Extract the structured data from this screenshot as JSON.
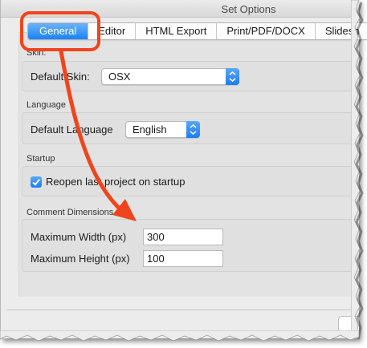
{
  "window": {
    "title": "Set Options"
  },
  "tabs": [
    {
      "label": "General",
      "active": true
    },
    {
      "label": "Editor",
      "active": false
    },
    {
      "label": "HTML Export",
      "active": false
    },
    {
      "label": "Print/PDF/DOCX",
      "active": false
    },
    {
      "label": "Slidesh",
      "active": false
    }
  ],
  "skin": {
    "group_label": "Skin:",
    "field_label": "Default Skin:",
    "value": "OSX"
  },
  "language": {
    "group_label": "Language",
    "field_label": "Default Language",
    "value": "English"
  },
  "startup": {
    "group_label": "Startup",
    "checkbox_label": "Reopen last project on startup",
    "checked": true
  },
  "comment_dimensions": {
    "group_label": "Comment Dimensions",
    "width_label": "Maximum Width (px)",
    "width_value": "300",
    "height_label": "Maximum Height (px)",
    "height_value": "100"
  },
  "annotation": {
    "color": "#f0451c"
  },
  "accent_color": "#1a82f7"
}
